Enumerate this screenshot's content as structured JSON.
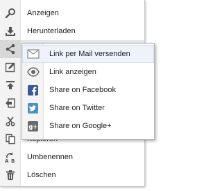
{
  "menu": {
    "items": [
      {
        "label": "Anzeigen",
        "icon": "search-icon"
      },
      {
        "label": "Herunterladen",
        "icon": "download-icon"
      },
      {
        "label": "",
        "icon": "share-icon"
      },
      {
        "label": "",
        "icon": "edit-icon"
      },
      {
        "label": "",
        "icon": "upload-icon"
      },
      {
        "label": "",
        "icon": "move-icon"
      },
      {
        "label": "",
        "icon": "cut-icon"
      },
      {
        "label": "Kopieren",
        "icon": "copy-icon"
      },
      {
        "label": "Umbenennen",
        "icon": "rename-icon"
      },
      {
        "label": "Löschen",
        "icon": "trash-icon"
      }
    ]
  },
  "submenu": {
    "items": [
      {
        "label": "Link per Mail versenden",
        "icon": "mail-icon"
      },
      {
        "label": "Link anzeigen",
        "icon": "eye-icon"
      },
      {
        "label": "Share on Facebook",
        "icon": "facebook-icon",
        "color": "#3b5998"
      },
      {
        "label": "Share on Twitter",
        "icon": "twitter-icon",
        "color": "#4a90c2"
      },
      {
        "label": "Share on Google+",
        "icon": "google-plus-icon",
        "color": "#6a6a6a"
      }
    ]
  },
  "colors": {
    "icon": "#555555",
    "icon_column": "#f3f3f3",
    "active_item": "#e6e6e6",
    "submenu_highlight": "#eef3fb"
  }
}
